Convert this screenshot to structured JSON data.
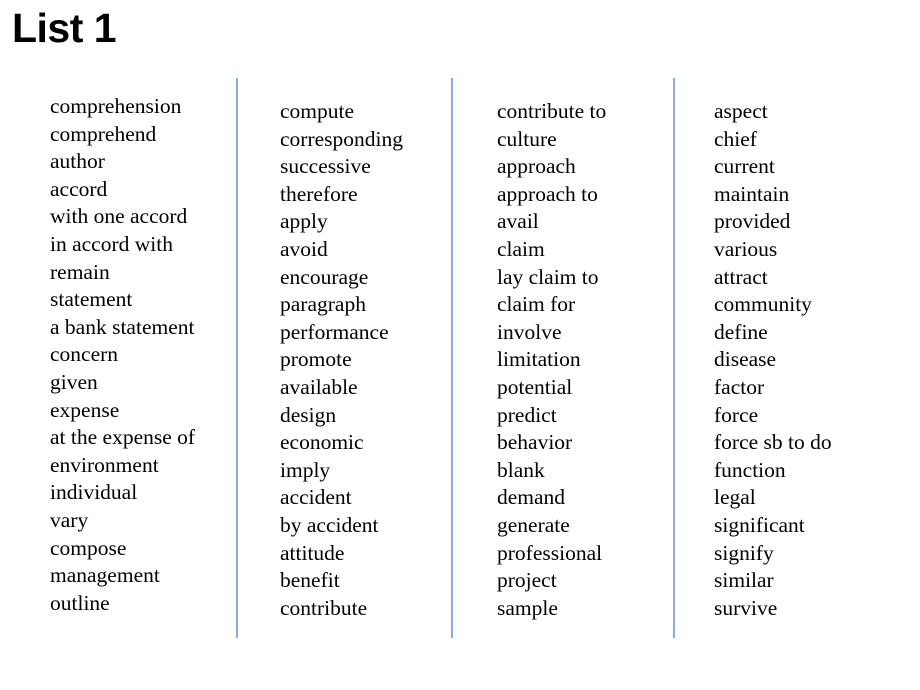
{
  "slide": {
    "title": "List 1",
    "background_color": "#FFFFFF",
    "text_color": "#000000",
    "divider_color": "#8FAADC"
  },
  "columns": [
    {
      "id": "column-1",
      "items": [
        "comprehension",
        "comprehend",
        "author",
        "accord",
        "with one accord",
        "in accord with",
        "remain",
        "statement",
        "a bank statement",
        "concern",
        "given",
        "expense",
        "at the expense of",
        "environment",
        "individual",
        "vary",
        "compose",
        "management",
        "outline"
      ]
    },
    {
      "id": "column-2",
      "items": [
        "compute",
        "corresponding",
        "successive",
        "therefore",
        "apply",
        "avoid",
        "encourage",
        "paragraph",
        "performance",
        "promote",
        "available",
        "design",
        "economic",
        "imply",
        "accident",
        "by accident",
        "attitude",
        "benefit",
        "contribute"
      ]
    },
    {
      "id": "column-3",
      "items": [
        "contribute to",
        "culture",
        "approach",
        "approach to",
        "avail",
        "claim",
        "lay claim to",
        "claim for",
        "involve",
        "limitation",
        "potential",
        "predict",
        "behavior",
        "blank",
        "demand",
        "generate",
        "professional",
        "project",
        "sample"
      ]
    },
    {
      "id": "column-4",
      "items": [
        "aspect",
        "chief",
        "current",
        "maintain",
        "provided",
        "various",
        "attract",
        "community",
        "define",
        "disease",
        "factor",
        "force",
        "force sb to do",
        "function",
        "legal",
        "significant",
        "signify",
        "similar",
        "survive"
      ]
    }
  ]
}
